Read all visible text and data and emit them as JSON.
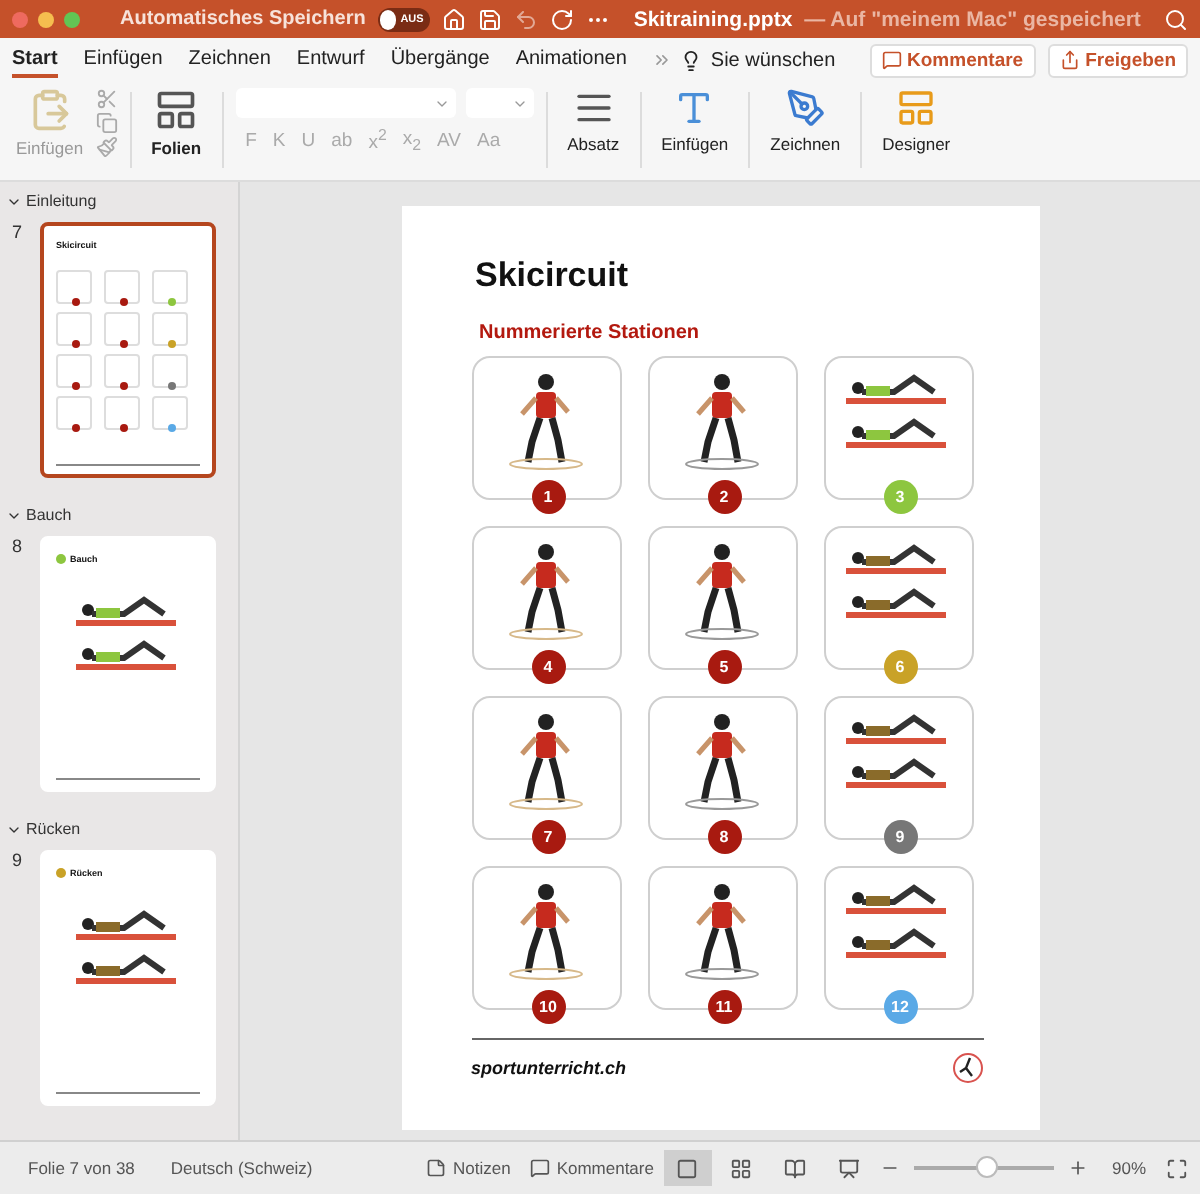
{
  "title_bar": {
    "autosave_label": "Automatisches Speichern",
    "autosave": {
      "label": "AUS",
      "on": false
    },
    "document_title": "Skitraining.pptx",
    "save_status": "— Auf \"meinem Mac\" gespeichert"
  },
  "tabs": [
    {
      "label": "Start",
      "selected": true
    },
    {
      "label": "Einfügen",
      "selected": false
    },
    {
      "label": "Zeichnen",
      "selected": false
    },
    {
      "label": "Entwurf",
      "selected": false
    },
    {
      "label": "Übergänge",
      "selected": false
    },
    {
      "label": "Animationen",
      "selected": false
    }
  ],
  "tell_me": "Sie wünschen",
  "actions": [
    {
      "label": "Kommentare",
      "kind": "comment"
    },
    {
      "label": "Freigeben",
      "kind": "share"
    }
  ],
  "ribbon": {
    "paste": {
      "label": "Einfügen",
      "disabled": true
    },
    "slides": {
      "label": "Folien"
    },
    "font": {
      "disabled": true,
      "buttons": [
        "F",
        "K",
        "U",
        "ab",
        "x$^{2}$",
        "x$_{2}$",
        "AV",
        "Aa"
      ]
    },
    "groups": [
      {
        "label": "Absatz",
        "kind": "paragraph"
      },
      {
        "label": "Einfügen",
        "kind": "insert"
      },
      {
        "label": "Zeichnen",
        "kind": "draw"
      },
      {
        "label": "Designer",
        "kind": "designer"
      }
    ]
  },
  "sidebar": {
    "sections": [
      {
        "title": "Einleitung",
        "expanded": true,
        "slides": [
          {
            "number": "7",
            "title": "Skicircuit",
            "selected": true,
            "kind": "circuit"
          }
        ]
      },
      {
        "title": "Bauch",
        "expanded": true,
        "slides": [
          {
            "number": "8",
            "title": "Bauch",
            "selected": false,
            "kind": "exercise",
            "color": "#8dc63f"
          }
        ]
      },
      {
        "title": "Rücken",
        "expanded": true,
        "slides": [
          {
            "number": "9",
            "title": "Rücken",
            "selected": false,
            "kind": "exercise",
            "color": "#c9a227"
          }
        ]
      }
    ]
  },
  "slide": {
    "title": "Skicircuit",
    "subtitle": "Nummerierte Stationen",
    "footer": "sportunterricht.ch",
    "stations": [
      {
        "number": "1",
        "color": "#a81a10"
      },
      {
        "number": "2",
        "color": "#a81a10"
      },
      {
        "number": "3",
        "color": "#8dc63f"
      },
      {
        "number": "4",
        "color": "#a81a10"
      },
      {
        "number": "5",
        "color": "#a81a10"
      },
      {
        "number": "6",
        "color": "#c9a227"
      },
      {
        "number": "7",
        "color": "#a81a10"
      },
      {
        "number": "8",
        "color": "#a81a10"
      },
      {
        "number": "9",
        "color": "#777777"
      },
      {
        "number": "10",
        "color": "#a81a10"
      },
      {
        "number": "11",
        "color": "#a81a10"
      },
      {
        "number": "12",
        "color": "#5aa9e6"
      }
    ]
  },
  "status_bar": {
    "slide_info": "Folie 7 von 38",
    "language": "Deutsch (Schweiz)",
    "notes": "Notizen",
    "comments": "Kommentare",
    "views": [
      {
        "kind": "normal",
        "selected": true
      },
      {
        "kind": "sorter",
        "selected": false
      },
      {
        "kind": "reading",
        "selected": false
      },
      {
        "kind": "presenter",
        "selected": false
      }
    ],
    "zoom": {
      "level": 0.52,
      "reading": "90%"
    }
  }
}
